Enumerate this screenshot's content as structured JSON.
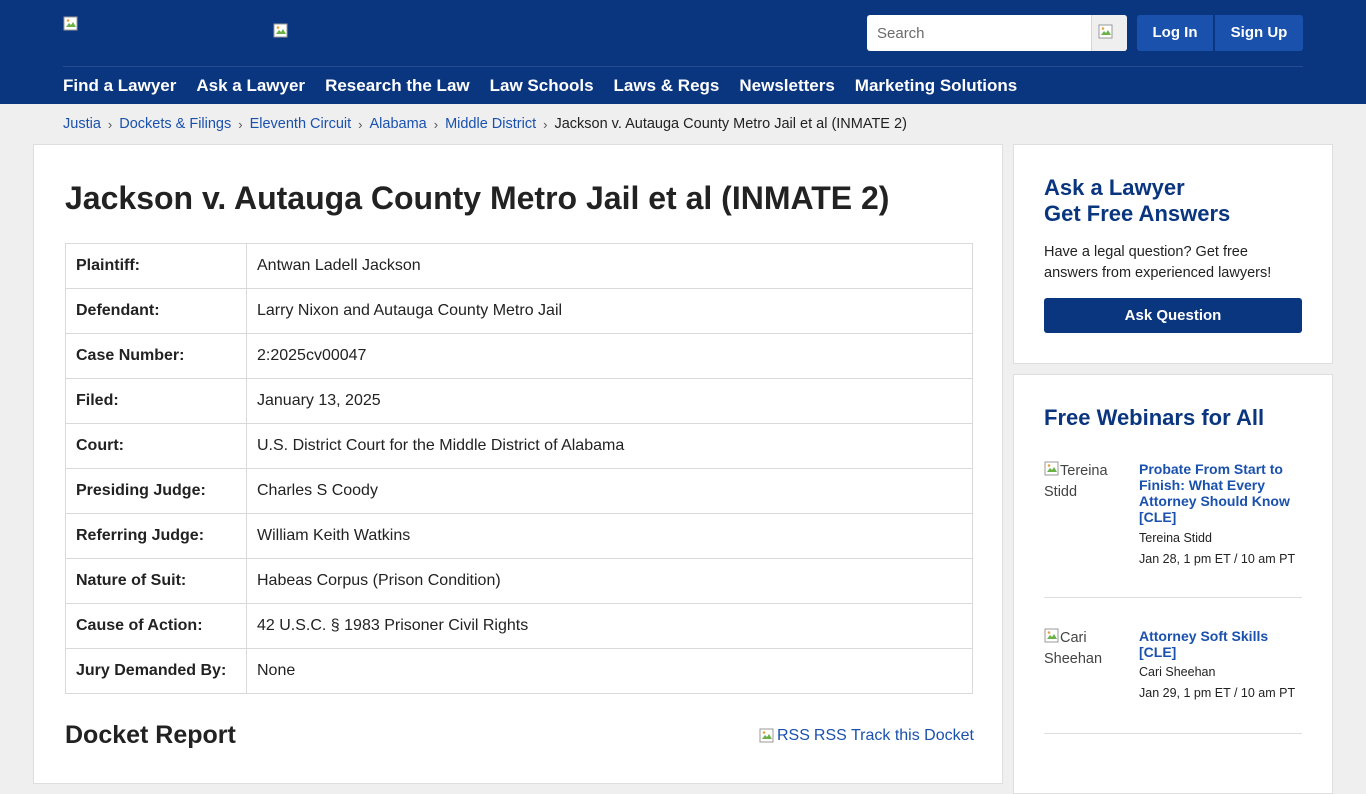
{
  "header": {
    "search_placeholder": "Search",
    "login_label": "Log In",
    "signup_label": "Sign Up",
    "nav": [
      "Find a Lawyer",
      "Ask a Lawyer",
      "Research the Law",
      "Law Schools",
      "Laws & Regs",
      "Newsletters",
      "Marketing Solutions"
    ]
  },
  "breadcrumb": {
    "items": [
      "Justia",
      "Dockets & Filings",
      "Eleventh Circuit",
      "Alabama",
      "Middle District"
    ],
    "current": "Jackson v. Autauga County Metro Jail et al (INMATE 2)",
    "separator": "›"
  },
  "case": {
    "title": "Jackson v. Autauga County Metro Jail et al (INMATE 2)",
    "facts": [
      {
        "label": "Plaintiff:",
        "value": "Antwan Ladell Jackson"
      },
      {
        "label": "Defendant:",
        "value": "Larry Nixon and Autauga County Metro Jail"
      },
      {
        "label": "Case Number:",
        "value": "2:2025cv00047"
      },
      {
        "label": "Filed:",
        "value": "January 13, 2025"
      },
      {
        "label": "Court:",
        "value": "U.S. District Court for the Middle District of Alabama"
      },
      {
        "label": "Presiding Judge:",
        "value": "Charles S Coody"
      },
      {
        "label": "Referring Judge:",
        "value": "William Keith Watkins"
      },
      {
        "label": "Nature of Suit:",
        "value": "Habeas Corpus (Prison Condition)"
      },
      {
        "label": "Cause of Action:",
        "value": "42 U.S.C. § 1983 Prisoner Civil Rights"
      },
      {
        "label": "Jury Demanded By:",
        "value": "None"
      }
    ],
    "docket_heading": "Docket Report",
    "rss_alt": "RSS",
    "rss_label": "RSS Track this Docket"
  },
  "sidebar": {
    "ask": {
      "title_line1": "Ask a Lawyer",
      "title_line2": "Get Free Answers",
      "body": "Have a legal question? Get free answers from experienced lawyers!",
      "button": "Ask Question"
    },
    "webinars": {
      "title": "Free Webinars for All",
      "items": [
        {
          "photo_alt": "Tereina Stidd",
          "title": "Probate From Start to Finish: What Every Attorney Should Know [CLE]",
          "presenter": "Tereina Stidd",
          "when": "Jan 28, 1 pm ET / 10 am PT"
        },
        {
          "photo_alt": "Cari Sheehan",
          "title": "Attorney Soft Skills [CLE]",
          "presenter": "Cari Sheehan",
          "when": "Jan 29, 1 pm ET / 10 am PT"
        }
      ]
    }
  },
  "colors": {
    "header_bg": "#0a357f",
    "button_bg": "#1a51ad",
    "link": "#1a51ad",
    "page_bg": "#efefef"
  }
}
